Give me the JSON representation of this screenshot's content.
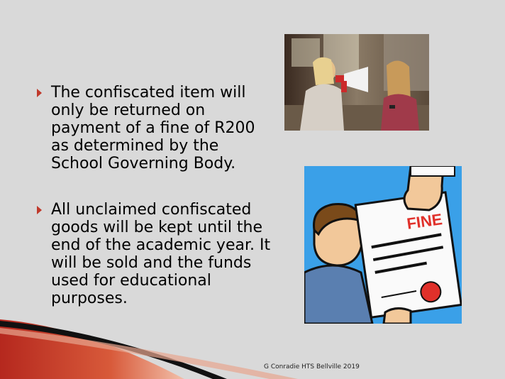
{
  "slide": {
    "bullets": [
      {
        "text": "The confiscated item will\nonly be returned on\npayment of a fine of R200\nas determined by the\nSchool Governing Body."
      },
      {
        "text": "All unclaimed confiscated\ngoods will be kept until the\nend of the academic year. It\nwill be sold and the funds\nused for educational\npurposes."
      }
    ],
    "cartoon_label": "FINE",
    "footer": "G Conradie HTS Bellville 2019"
  },
  "colors": {
    "background": "#d9d9d9",
    "bullet_marker": "#c0392b",
    "swoosh_red": "#c0392b",
    "cartoon_sky": "#3aa0e8",
    "fine_text": "#e0302a"
  },
  "icons": [
    "bullet-triangle-icon",
    "megaphone-icon"
  ]
}
